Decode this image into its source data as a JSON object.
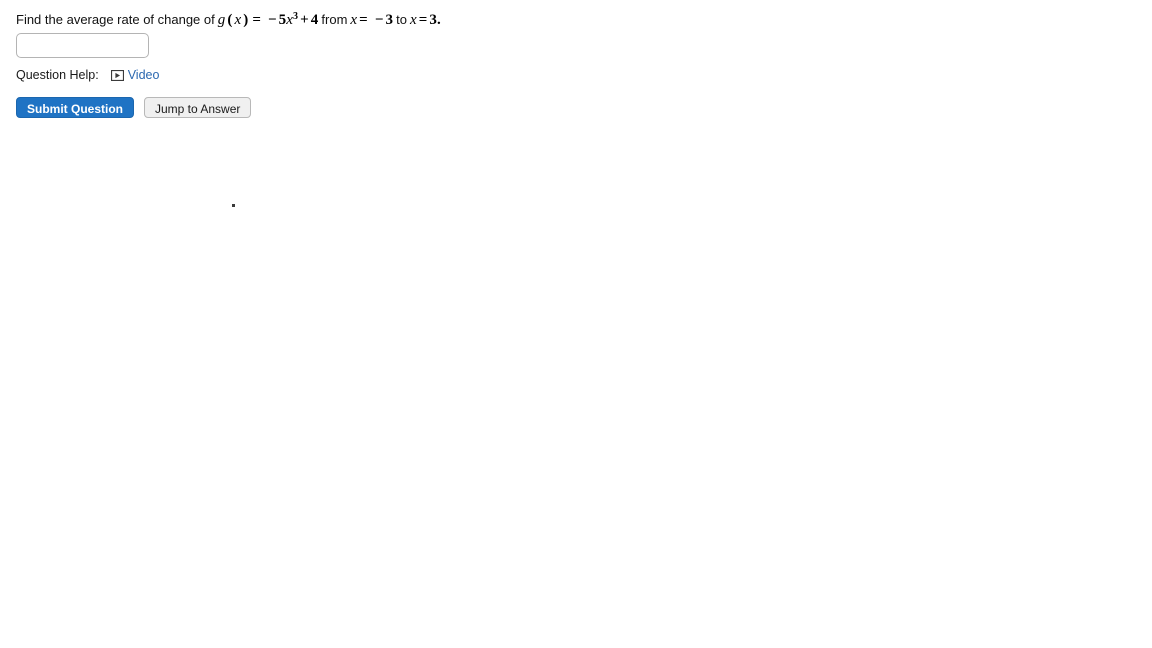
{
  "question": {
    "lead_text": "Find the average rate of change of",
    "function_name": "g",
    "function_var": "x",
    "equals": "=",
    "minus": "−",
    "coefficient": "5",
    "variable": "x",
    "exponent": "3",
    "plus": "+",
    "constant": "4",
    "from_word": "from",
    "x_var": "x",
    "x_start": "3",
    "to_word": "to",
    "x_end": "3",
    "period": ".",
    "full_text": "Find the average rate of change of g(x) = − 5x³ + 4 from x = − 3 to x = 3."
  },
  "answer": {
    "value": "",
    "placeholder": ""
  },
  "help": {
    "label": "Question Help:",
    "video_icon": "video-play-icon",
    "video_link": "Video"
  },
  "buttons": {
    "submit_label": "Submit Question",
    "jump_label": "Jump to Answer"
  },
  "colors": {
    "primary_blue": "#1f73c4",
    "link_blue": "#2b68b0",
    "secondary_bg": "#f0f0f0",
    "input_border": "#b4b4b4",
    "page_bg": "#ffffff"
  }
}
